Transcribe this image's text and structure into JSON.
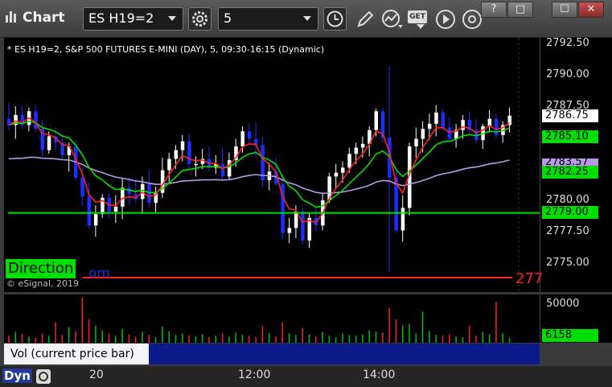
{
  "app": {
    "title": "Chart"
  },
  "toolbar": {
    "symbol": "ES H19=2",
    "interval": "5",
    "get_label": "GET"
  },
  "window_controls": {
    "help": "?",
    "restore": "□",
    "maximize": "☐",
    "close": "✕"
  },
  "chart": {
    "header": "* ES H19=2, S&P 500 FUTURES E-MINI (DAY), 5, 09:30-16:15 (Dynamic)",
    "watermark": "© eSignal, 2019",
    "direction_label": "Direction",
    "direction_tail": "om",
    "last_red_label": "277",
    "price_ticks": [
      "2792.50",
      "2790.00",
      "2787.50",
      "2785.00",
      "2782.50",
      "2780.00",
      "2777.50",
      "2775.00"
    ],
    "tags": {
      "last": "2786.75",
      "ma1": "2785.10",
      "ma2": "2783.57",
      "ma3": "2782.25",
      "level": "2779.00"
    },
    "time_ticks": [
      "20",
      "12:00",
      "14:00"
    ],
    "colors": {
      "up": "#ffffff",
      "down": "#1a2fff",
      "ma_red": "#ff2020",
      "ma_green": "#00e000",
      "ma_purple": "#b69ce6"
    }
  },
  "volume_panel": {
    "label": "Vol (current price bar)",
    "close": "x",
    "ticks": [
      "50000"
    ],
    "current": "6158"
  },
  "status": {
    "dyn": "Dyn"
  },
  "chart_data": {
    "type": "candlestick",
    "title": "* ES H19=2, S&P 500 FUTURES E-MINI (DAY), 5, 09:30-16:15 (Dynamic)",
    "ylim": [
      2773.5,
      2793.3
    ],
    "horizontal_levels": [
      2779.0,
      2774.0
    ],
    "candles": [
      [
        2786.5,
        2787.8,
        2785.6,
        2786.0
      ],
      [
        2786.0,
        2787.5,
        2784.9,
        2786.8
      ],
      [
        2786.8,
        2787.5,
        2785.7,
        2786.0
      ],
      [
        2786.0,
        2787.4,
        2785.5,
        2787.1
      ],
      [
        2787.1,
        2787.6,
        2785.4,
        2785.7
      ],
      [
        2785.7,
        2786.4,
        2783.5,
        2784.0
      ],
      [
        2784.0,
        2785.5,
        2783.7,
        2785.1
      ],
      [
        2785.1,
        2785.8,
        2784.0,
        2784.6
      ],
      [
        2784.6,
        2785.2,
        2783.3,
        2783.6
      ],
      [
        2783.6,
        2784.6,
        2782.3,
        2784.3
      ],
      [
        2784.3,
        2784.8,
        2781.6,
        2781.8
      ],
      [
        2781.8,
        2782.6,
        2779.5,
        2780.3
      ],
      [
        2780.3,
        2781.4,
        2777.8,
        2778.0
      ],
      [
        2778.0,
        2779.6,
        2777.1,
        2778.9
      ],
      [
        2778.9,
        2780.5,
        2778.6,
        2780.2
      ],
      [
        2780.2,
        2780.6,
        2778.6,
        2779.1
      ],
      [
        2779.1,
        2780.4,
        2778.2,
        2779.5
      ],
      [
        2779.5,
        2781.8,
        2778.5,
        2781.0
      ],
      [
        2781.0,
        2781.8,
        2779.7,
        2780.5
      ],
      [
        2780.5,
        2781.7,
        2779.8,
        2780.1
      ],
      [
        2780.1,
        2781.9,
        2778.9,
        2781.3
      ],
      [
        2781.3,
        2782.4,
        2779.4,
        2779.8
      ],
      [
        2779.8,
        2781.1,
        2779.0,
        2780.6
      ],
      [
        2780.6,
        2783.4,
        2780.2,
        2782.4
      ],
      [
        2782.4,
        2783.8,
        2781.4,
        2783.3
      ],
      [
        2783.3,
        2784.4,
        2782.5,
        2784.0
      ],
      [
        2784.0,
        2785.2,
        2783.1,
        2784.7
      ],
      [
        2784.7,
        2785.3,
        2782.4,
        2782.9
      ],
      [
        2782.9,
        2783.5,
        2781.9,
        2782.9
      ],
      [
        2782.9,
        2784.1,
        2782.5,
        2783.3
      ],
      [
        2783.3,
        2784.3,
        2782.3,
        2782.6
      ],
      [
        2782.6,
        2783.6,
        2782.1,
        2782.9
      ],
      [
        2782.9,
        2784.2,
        2781.6,
        2781.9
      ],
      [
        2781.9,
        2783.8,
        2781.7,
        2783.2
      ],
      [
        2783.2,
        2784.9,
        2782.7,
        2784.3
      ],
      [
        2784.3,
        2785.9,
        2783.8,
        2785.5
      ],
      [
        2785.5,
        2786.1,
        2784.4,
        2784.9
      ],
      [
        2784.9,
        2786.2,
        2783.4,
        2784.4
      ],
      [
        2784.4,
        2785.1,
        2781.1,
        2781.6
      ],
      [
        2781.6,
        2783.0,
        2780.8,
        2782.3
      ],
      [
        2782.3,
        2783.4,
        2781.2,
        2781.3
      ],
      [
        2781.3,
        2781.8,
        2776.9,
        2777.4
      ],
      [
        2777.4,
        2778.6,
        2776.6,
        2777.8
      ],
      [
        2777.8,
        2779.6,
        2777.0,
        2779.1
      ],
      [
        2779.1,
        2779.4,
        2776.5,
        2776.8
      ],
      [
        2776.8,
        2779.0,
        2776.2,
        2778.6
      ],
      [
        2778.6,
        2779.4,
        2777.6,
        2778.0
      ],
      [
        2778.0,
        2780.6,
        2777.6,
        2780.0
      ],
      [
        2780.0,
        2782.2,
        2779.8,
        2781.9
      ],
      [
        2781.9,
        2782.9,
        2780.9,
        2782.2
      ],
      [
        2782.2,
        2783.1,
        2781.4,
        2782.6
      ],
      [
        2782.6,
        2784.2,
        2782.2,
        2783.7
      ],
      [
        2783.7,
        2784.6,
        2782.9,
        2784.2
      ],
      [
        2784.2,
        2785.1,
        2783.4,
        2784.5
      ],
      [
        2784.5,
        2785.9,
        2783.5,
        2785.6
      ],
      [
        2785.6,
        2787.3,
        2785.1,
        2787.1
      ],
      [
        2787.1,
        2787.4,
        2784.6,
        2785.0
      ],
      [
        2785.0,
        2790.7,
        2774.3,
        2781.8
      ],
      [
        2781.8,
        2782.4,
        2777.4,
        2777.6
      ],
      [
        2777.6,
        2780.4,
        2776.7,
        2779.4
      ],
      [
        2779.4,
        2784.6,
        2778.8,
        2784.3
      ],
      [
        2784.3,
        2785.8,
        2783.4,
        2784.9
      ],
      [
        2784.9,
        2786.3,
        2783.8,
        2785.7
      ],
      [
        2785.7,
        2786.9,
        2784.8,
        2786.1
      ],
      [
        2786.1,
        2787.6,
        2785.1,
        2787.0
      ],
      [
        2787.0,
        2787.3,
        2785.6,
        2785.8
      ],
      [
        2785.8,
        2786.6,
        2784.6,
        2784.9
      ],
      [
        2784.9,
        2786.1,
        2784.2,
        2785.6
      ],
      [
        2785.6,
        2786.8,
        2784.9,
        2786.4
      ],
      [
        2786.4,
        2787.1,
        2785.3,
        2785.6
      ],
      [
        2785.6,
        2786.5,
        2784.5,
        2784.8
      ],
      [
        2784.8,
        2786.1,
        2784.1,
        2785.9
      ],
      [
        2785.9,
        2787.2,
        2785.4,
        2786.5
      ],
      [
        2786.5,
        2786.9,
        2785.0,
        2785.2
      ],
      [
        2785.2,
        2786.3,
        2784.6,
        2786.0
      ],
      [
        2786.0,
        2787.4,
        2785.4,
        2786.75
      ]
    ],
    "volume_max": 60000,
    "volume_current": 6158
  }
}
